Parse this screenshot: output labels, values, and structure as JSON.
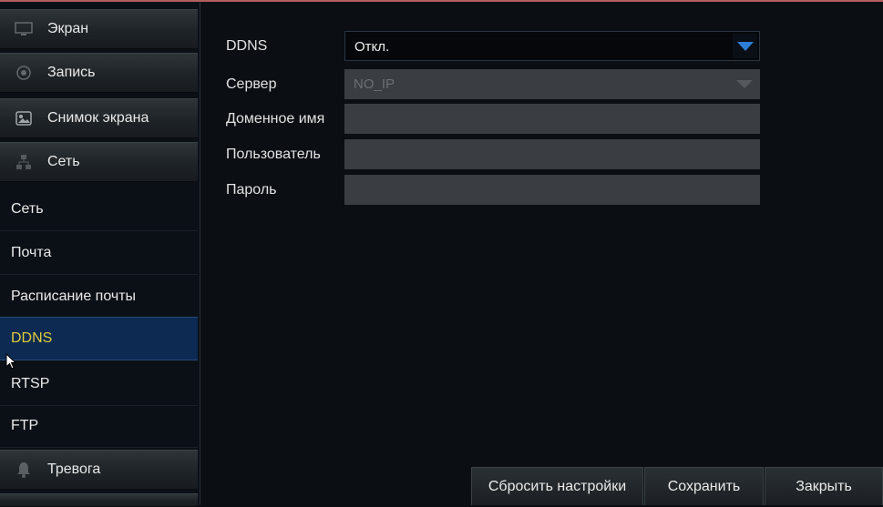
{
  "sidebar": {
    "categories_top": [
      {
        "label": "Экран",
        "icon": "monitor-icon"
      },
      {
        "label": "Запись",
        "icon": "record-icon"
      },
      {
        "label": "Снимок экрана",
        "icon": "snapshot-icon"
      },
      {
        "label": "Сеть",
        "icon": "network-icon"
      }
    ],
    "subitems": [
      {
        "label": "Сеть"
      },
      {
        "label": "Почта"
      },
      {
        "label": "Расписание почты"
      },
      {
        "label": "DDNS",
        "active": true
      },
      {
        "label": "RTSP"
      },
      {
        "label": "FTP"
      }
    ],
    "categories_bottom": [
      {
        "label": "Тревога",
        "icon": "alarm-icon"
      }
    ]
  },
  "form": {
    "ddns": {
      "label": "DDNS",
      "value": "Откл."
    },
    "server": {
      "label": "Сервер",
      "value": "NO_IP"
    },
    "domain": {
      "label": "Доменное имя",
      "value": ""
    },
    "user": {
      "label": "Пользователь",
      "value": ""
    },
    "password": {
      "label": "Пароль",
      "value": ""
    }
  },
  "buttons": {
    "reset": "Сбросить настройки",
    "save": "Сохранить",
    "close": "Закрыть"
  },
  "colors": {
    "active_item_bg": "#0c2a52",
    "active_item_text": "#e0cc3a",
    "dropdown_arrow": "#2e7ed8"
  }
}
